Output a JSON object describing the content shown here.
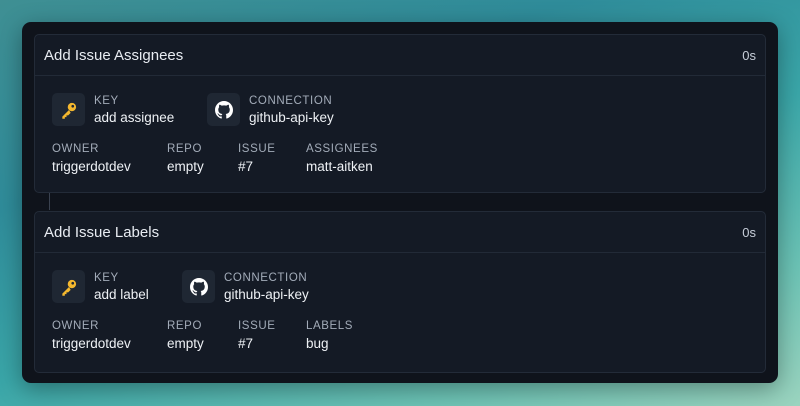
{
  "cards": [
    {
      "title": "Add Issue Assignees",
      "time": "0s",
      "key_label": "KEY",
      "key_value": "add assignee",
      "connection_label": "CONNECTION",
      "connection_value": "github-api-key",
      "fields": [
        {
          "label": "OWNER",
          "value": "triggerdotdev"
        },
        {
          "label": "REPO",
          "value": "empty"
        },
        {
          "label": "ISSUE",
          "value": "#7"
        },
        {
          "label": "ASSIGNEES",
          "value": "matt-aitken"
        }
      ]
    },
    {
      "title": "Add Issue Labels",
      "time": "0s",
      "key_label": "KEY",
      "key_value": "add label",
      "connection_label": "CONNECTION",
      "connection_value": "github-api-key",
      "fields": [
        {
          "label": "OWNER",
          "value": "triggerdotdev"
        },
        {
          "label": "REPO",
          "value": "empty"
        },
        {
          "label": "ISSUE",
          "value": "#7"
        },
        {
          "label": "LABELS",
          "value": "bug"
        }
      ]
    }
  ],
  "icons": {
    "key": "key-icon",
    "connection": "github-icon"
  },
  "colors": {
    "key_icon": "#f5b82e",
    "panel": "#0f131b",
    "card": "#141a25"
  }
}
